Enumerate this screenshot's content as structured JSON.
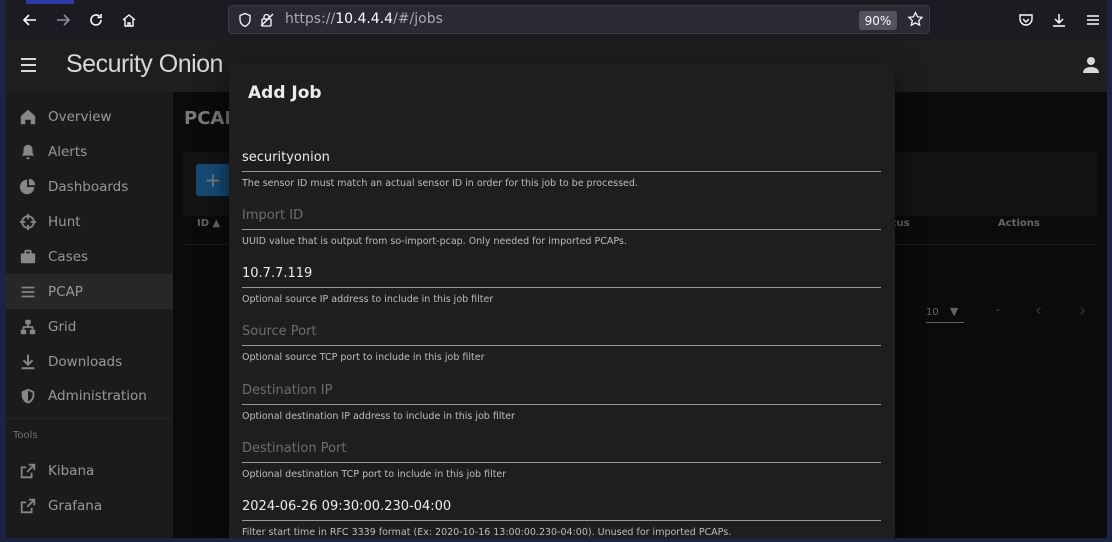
{
  "browser": {
    "url_prefix": "https://",
    "url_host": "10.4.4.4",
    "url_path": "/#/jobs",
    "zoom": "90%"
  },
  "app": {
    "brand": "Security Onion"
  },
  "sidebar": {
    "items": [
      {
        "label": "Overview",
        "icon": "home-icon"
      },
      {
        "label": "Alerts",
        "icon": "bell-icon"
      },
      {
        "label": "Dashboards",
        "icon": "pie-chart-icon"
      },
      {
        "label": "Hunt",
        "icon": "crosshair-icon"
      },
      {
        "label": "Cases",
        "icon": "briefcase-icon"
      },
      {
        "label": "PCAP",
        "icon": "list-icon",
        "active": true
      },
      {
        "label": "Grid",
        "icon": "sitemap-icon"
      },
      {
        "label": "Downloads",
        "icon": "download-icon"
      },
      {
        "label": "Administration",
        "icon": "shield-icon"
      }
    ],
    "tools_heading": "Tools",
    "tools": [
      {
        "label": "Kibana",
        "icon": "external-link-icon"
      },
      {
        "label": "Grafana",
        "icon": "external-link-icon"
      }
    ]
  },
  "main": {
    "title": "PCAP",
    "add_label": "+",
    "col_id": "ID",
    "col_status": "Status",
    "col_actions": "Actions",
    "rows_per_page": "10",
    "range": "-"
  },
  "modal": {
    "title": "Add Job",
    "fields": [
      {
        "value": "securityonion",
        "placeholder": "",
        "hint": "The sensor ID must match an actual sensor ID in order for this job to be processed."
      },
      {
        "value": "",
        "placeholder": "Import ID",
        "hint": "UUID value that is output from so-import-pcap. Only needed for imported PCAPs."
      },
      {
        "value": "10.7.7.119",
        "placeholder": "",
        "hint": "Optional source IP address to include in this job filter"
      },
      {
        "value": "",
        "placeholder": "Source Port",
        "hint": "Optional source TCP port to include in this job filter"
      },
      {
        "value": "",
        "placeholder": "Destination IP",
        "hint": "Optional destination IP address to include in this job filter"
      },
      {
        "value": "",
        "placeholder": "Destination Port",
        "hint": "Optional destination TCP port to include in this job filter"
      },
      {
        "value": "2024-06-26 09:30:00.230-04:00",
        "placeholder": "",
        "hint": "Filter start time in RFC 3339 format (Ex: 2020-10-16 13:00:00.230-04:00). Unused for imported PCAPs."
      }
    ]
  }
}
